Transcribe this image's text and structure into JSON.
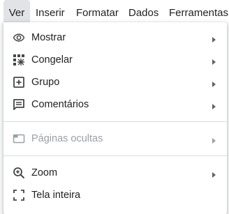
{
  "menubar": {
    "items": [
      "Ver",
      "Inserir",
      "Formatar",
      "Dados",
      "Ferramentas"
    ],
    "active": "Ver"
  },
  "menu": {
    "items": [
      {
        "label": "Mostrar",
        "icon": "eye-icon",
        "submenu": true
      },
      {
        "label": "Congelar",
        "icon": "freeze-grid-icon",
        "submenu": true
      },
      {
        "label": "Grupo",
        "icon": "add-box-icon",
        "submenu": true
      },
      {
        "label": "Comentários",
        "icon": "comment-icon",
        "submenu": true
      },
      {
        "label": "Páginas ocultas",
        "icon": "hidden-tab-icon",
        "submenu": true,
        "disabled": true
      },
      {
        "label": "Zoom",
        "icon": "zoom-in-icon",
        "submenu": true
      },
      {
        "label": "Tela inteira",
        "icon": "fullscreen-icon",
        "submenu": false
      }
    ]
  },
  "colors": {
    "text": "#202124",
    "icon": "#444746",
    "disabled": "#9aa0a6",
    "divider": "#dadce0",
    "active_tab_bg": "#e1e3e7"
  }
}
